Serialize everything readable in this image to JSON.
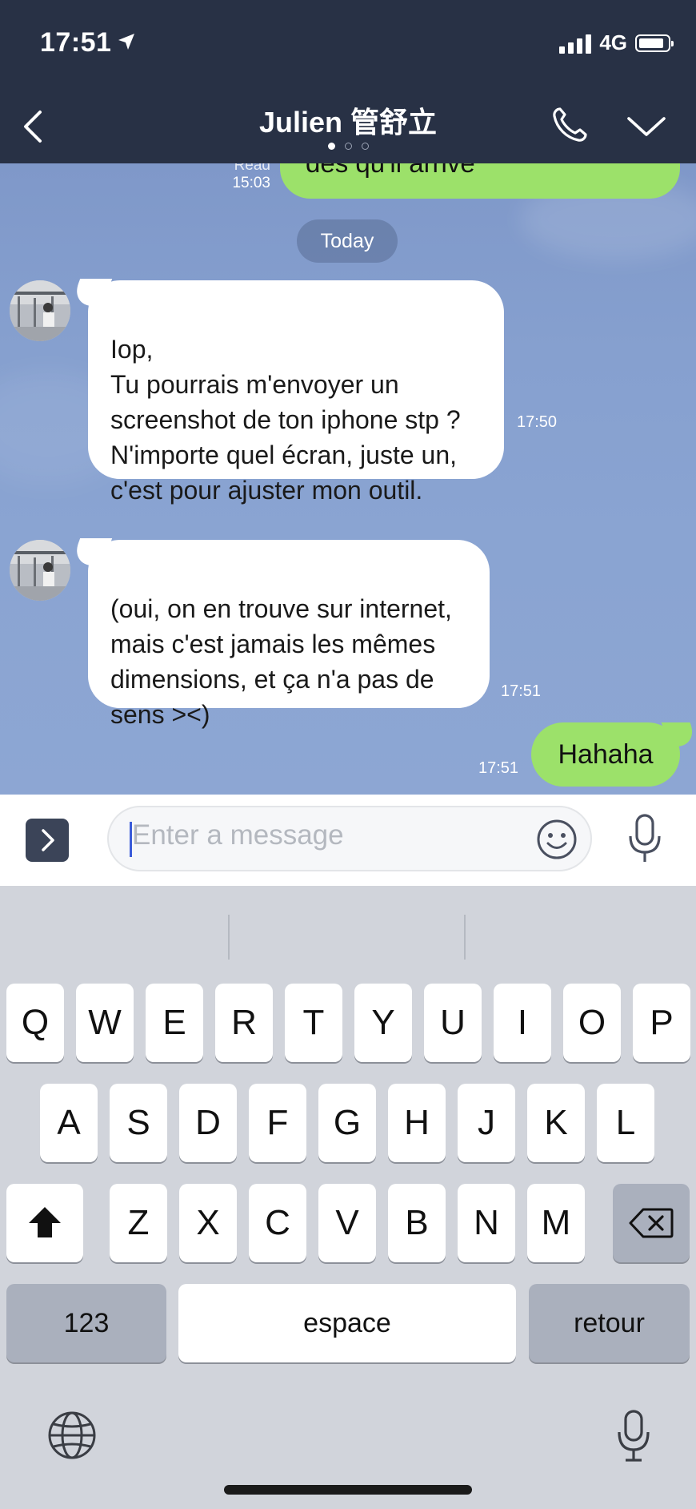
{
  "status": {
    "time": "17:51",
    "network": "4G"
  },
  "nav": {
    "title": "Julien 管舒立"
  },
  "messages": {
    "prev_out": {
      "text": "dès qu'il arrive",
      "read_label": "Read",
      "time": "15:03"
    },
    "date_separator": "Today",
    "in1": {
      "text": "Iop,\nTu pourrais m'envoyer un screenshot de ton iphone stp ? N'importe quel écran, juste un, c'est pour ajuster mon outil.",
      "time": "17:50"
    },
    "in2": {
      "text": "(oui, on en trouve sur internet, mais c'est jamais les mêmes dimensions, et ça n'a pas de sens ><)",
      "time": "17:51"
    },
    "out1": {
      "text": "Hahaha",
      "time": "17:51"
    }
  },
  "composer": {
    "placeholder": "Enter a message"
  },
  "keyboard": {
    "row1": [
      "Q",
      "W",
      "E",
      "R",
      "T",
      "Y",
      "U",
      "I",
      "O",
      "P"
    ],
    "row2": [
      "A",
      "S",
      "D",
      "F",
      "G",
      "H",
      "J",
      "K",
      "L"
    ],
    "row3": [
      "Z",
      "X",
      "C",
      "V",
      "B",
      "N",
      "M"
    ],
    "numbers_label": "123",
    "space_label": "espace",
    "return_label": "retour"
  },
  "colors": {
    "header": "#283145",
    "outgoing_bubble": "#9ce16a",
    "incoming_bubble": "#ffffff",
    "chat_background": "#86a0cf"
  }
}
